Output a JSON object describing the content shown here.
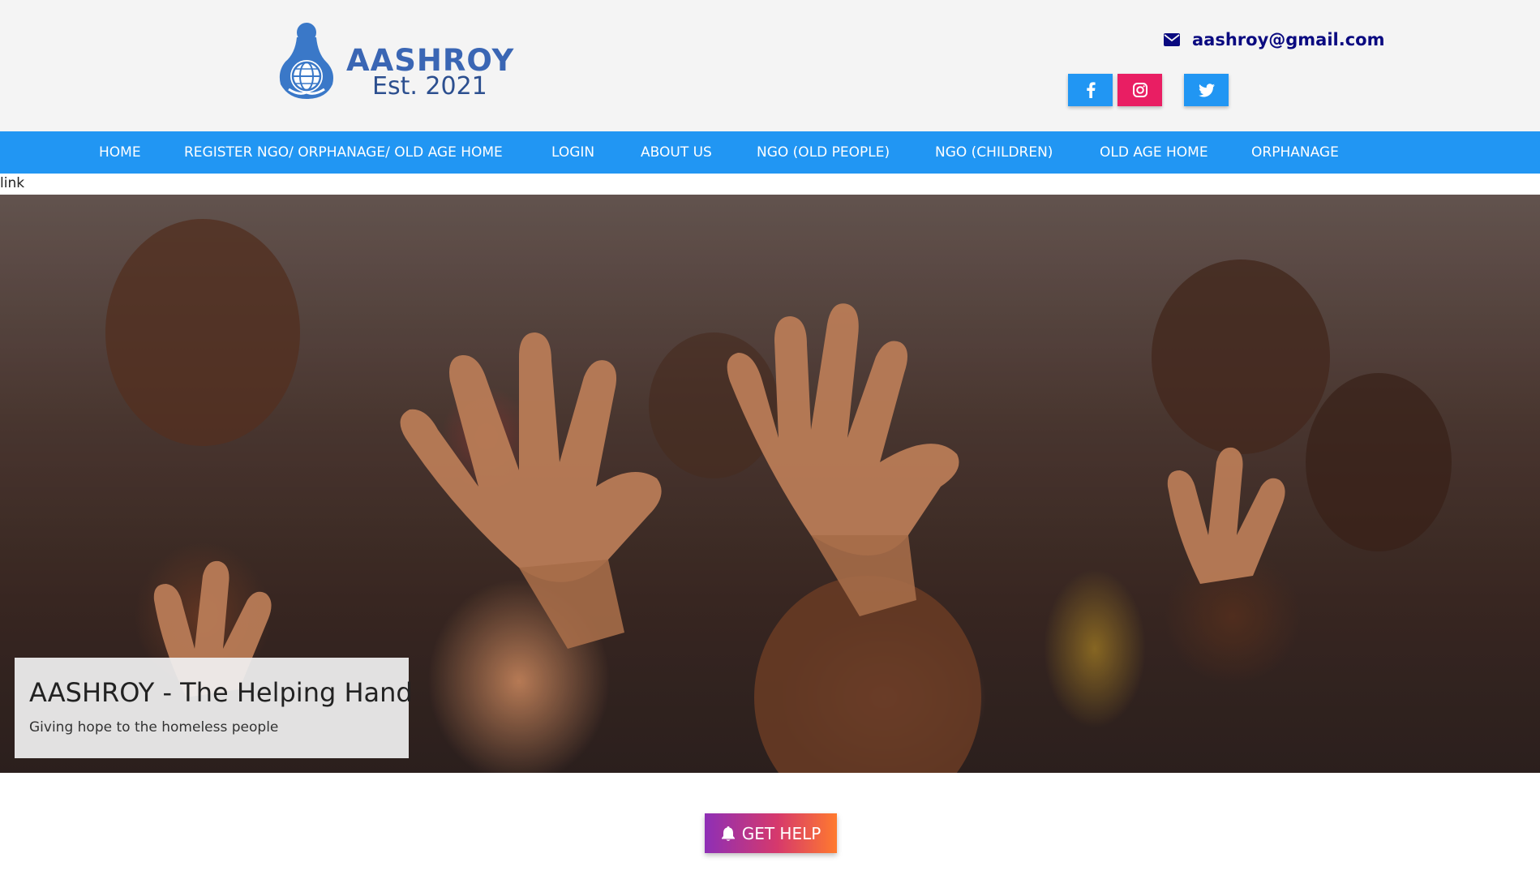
{
  "header": {
    "logo": {
      "title": "AASHROY",
      "subtitle": "Est. 2021"
    },
    "email": "aashroy@gmail.com",
    "social": [
      {
        "name": "facebook",
        "icon": "facebook-icon",
        "color": "#2196f3"
      },
      {
        "name": "instagram",
        "icon": "instagram-icon",
        "color": "#e91e63"
      },
      {
        "name": "twitter",
        "icon": "twitter-icon",
        "color": "#2196f3"
      }
    ]
  },
  "nav": {
    "items": [
      "HOME",
      "REGISTER NGO/ ORPHANAGE/ OLD AGE HOME",
      "LOGIN",
      "ABOUT US",
      "NGO (OLD PEOPLE)",
      "NGO (CHILDREN)",
      "OLD AGE HOME",
      "ORPHANAGE"
    ]
  },
  "link_text": "link",
  "hero": {
    "title": "AASHROY - The Helping Hand",
    "subtitle": "Giving hope to the homeless people"
  },
  "cta": {
    "label": "GET HELP",
    "icon": "bell-icon"
  },
  "colors": {
    "nav_bg": "#2196f3",
    "header_bg": "#f4f4f4",
    "email_color": "#0a0a80",
    "brand_blue": "#3a66b4",
    "cta_gradient": [
      "#8e2fb6",
      "#d6396c",
      "#ff7a2e"
    ]
  }
}
